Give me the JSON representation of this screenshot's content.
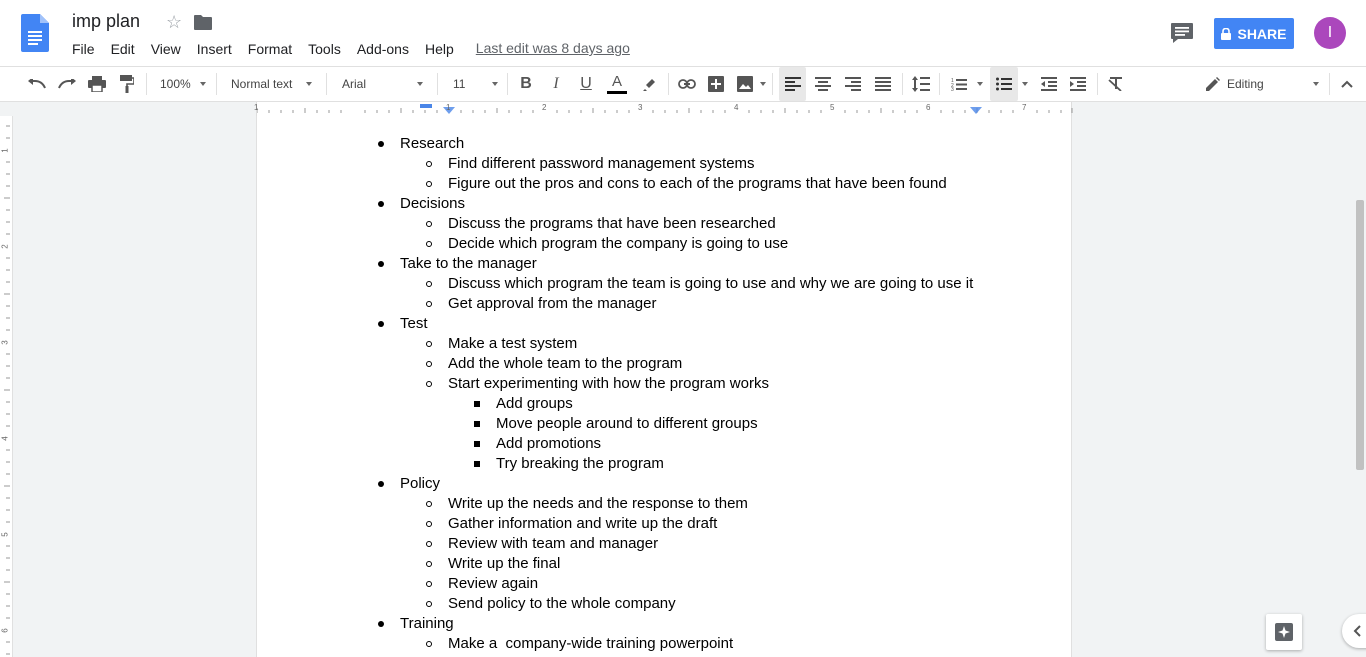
{
  "header": {
    "title": "imp plan",
    "last_edit": "Last edit was 8 days ago",
    "share_label": "SHARE",
    "avatar_initial": "I",
    "menu": [
      "File",
      "Edit",
      "View",
      "Insert",
      "Format",
      "Tools",
      "Add-ons",
      "Help"
    ]
  },
  "toolbar": {
    "zoom": "100%",
    "style": "Normal text",
    "font": "Arial",
    "font_size": "11",
    "mode": "Editing"
  },
  "ruler": {
    "top_numbers": [
      "1",
      "1",
      "2",
      "3",
      "4",
      "5",
      "6",
      "7"
    ],
    "left_numbers": [
      "1",
      "2",
      "3",
      "4",
      "5",
      "6"
    ]
  },
  "document": {
    "lines": [
      {
        "level": 1,
        "text": "Research"
      },
      {
        "level": 2,
        "text": "Find different password management systems"
      },
      {
        "level": 2,
        "text": "Figure out the pros and cons to each of the programs that have been found"
      },
      {
        "level": 1,
        "text": "Decisions"
      },
      {
        "level": 2,
        "text": "Discuss the programs that have been researched"
      },
      {
        "level": 2,
        "text": "Decide which program the company is going to use"
      },
      {
        "level": 1,
        "text": "Take to the manager"
      },
      {
        "level": 2,
        "text": "Discuss which program the team is going to use and why we are going to use it"
      },
      {
        "level": 2,
        "text": "Get approval from the manager"
      },
      {
        "level": 1,
        "text": "Test"
      },
      {
        "level": 2,
        "text": "Make a test system"
      },
      {
        "level": 2,
        "text": "Add the whole team to the program"
      },
      {
        "level": 2,
        "text": "Start experimenting with how the program works"
      },
      {
        "level": 3,
        "text": "Add groups"
      },
      {
        "level": 3,
        "text": "Move people around to different groups"
      },
      {
        "level": 3,
        "text": "Add promotions"
      },
      {
        "level": 3,
        "text": "Try breaking the program"
      },
      {
        "level": 1,
        "text": "Policy"
      },
      {
        "level": 2,
        "text": "Write up the needs and the response to them"
      },
      {
        "level": 2,
        "text": "Gather information and write up the draft"
      },
      {
        "level": 2,
        "text": "Review with team and manager"
      },
      {
        "level": 2,
        "text": "Write up the final"
      },
      {
        "level": 2,
        "text": "Review again"
      },
      {
        "level": 2,
        "text": "Send policy to the whole company"
      },
      {
        "level": 1,
        "text": "Training"
      },
      {
        "level": 2,
        "text": "Make a  company-wide training powerpoint"
      }
    ]
  },
  "colors": {
    "share": "#4285f4",
    "avatar": "#ab47bc",
    "docs_blue": "#4285f4"
  }
}
